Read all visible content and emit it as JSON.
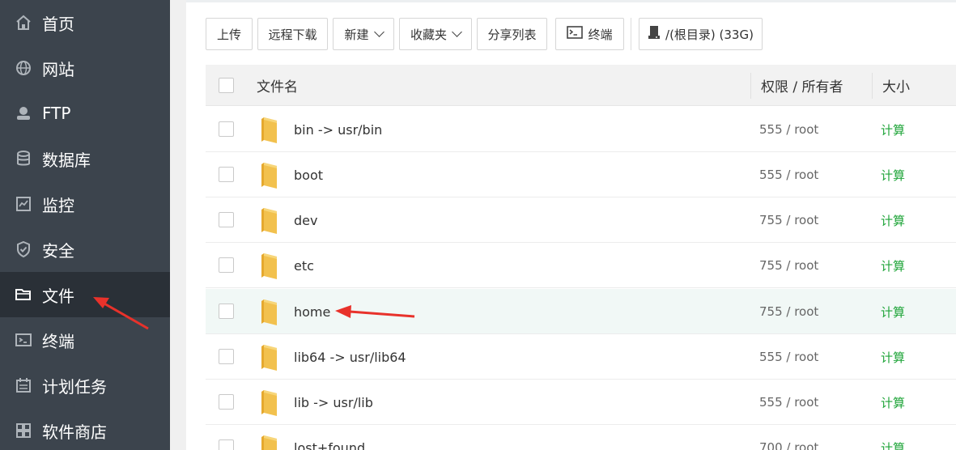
{
  "sidebar": {
    "items": [
      {
        "label": "首页",
        "icon": "home-icon"
      },
      {
        "label": "网站",
        "icon": "globe-icon"
      },
      {
        "label": "FTP",
        "icon": "ftp-icon"
      },
      {
        "label": "数据库",
        "icon": "database-icon"
      },
      {
        "label": "监控",
        "icon": "monitor-icon"
      },
      {
        "label": "安全",
        "icon": "shield-icon"
      },
      {
        "label": "文件",
        "icon": "folder-icon",
        "active": true
      },
      {
        "label": "终端",
        "icon": "terminal-icon"
      },
      {
        "label": "计划任务",
        "icon": "calendar-icon"
      },
      {
        "label": "软件商店",
        "icon": "apps-icon"
      }
    ]
  },
  "toolbar": {
    "upload": "上传",
    "remote_download": "远程下载",
    "new": "新建",
    "favorites": "收藏夹",
    "share_list": "分享列表",
    "terminal": "终端",
    "disk": "/(根目录) (33G)"
  },
  "table": {
    "headers": {
      "name": "文件名",
      "perm": "权限 / 所有者",
      "size": "大小"
    },
    "rows": [
      {
        "name": "bin -> usr/bin",
        "perm": "555 / root",
        "size": "计算"
      },
      {
        "name": "boot",
        "perm": "555 / root",
        "size": "计算"
      },
      {
        "name": "dev",
        "perm": "755 / root",
        "size": "计算"
      },
      {
        "name": "etc",
        "perm": "755 / root",
        "size": "计算"
      },
      {
        "name": "home",
        "perm": "755 / root",
        "size": "计算",
        "highlight": true
      },
      {
        "name": "lib64 -> usr/lib64",
        "perm": "555 / root",
        "size": "计算"
      },
      {
        "name": "lib -> usr/lib",
        "perm": "555 / root",
        "size": "计算"
      },
      {
        "name": "lost+found",
        "perm": "700 / root",
        "size": "计算"
      }
    ]
  },
  "colors": {
    "sidebar_bg": "#3c444d",
    "active_bg": "#2a3037",
    "accent_green": "#20a53a",
    "annotation_red": "#e8322b"
  }
}
